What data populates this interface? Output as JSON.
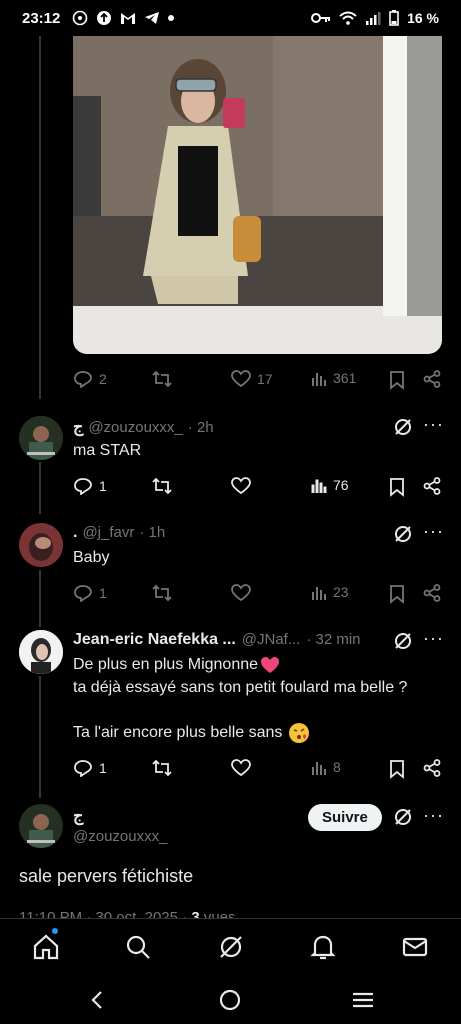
{
  "status_bar": {
    "time": "23:12",
    "battery": "16 %"
  },
  "main_post_stats": {
    "replies": "2",
    "likes": "17",
    "views": "361"
  },
  "replies": [
    {
      "name": "ج",
      "handle": "@zouzouxxx_",
      "time": "· 2h",
      "text": "ma STAR",
      "reply_count": "1",
      "views": "76"
    },
    {
      "name": ".",
      "handle": "@j_favr",
      "time": "· 1h",
      "text": "Baby",
      "reply_count": "1",
      "views": "23"
    },
    {
      "name": "Jean-eric Naefekka ...",
      "handle": "@JNaf...",
      "time": "· 32 min",
      "line1": "De plus en plus Mignonne",
      "line2": "ta déjà essayé sans ton petit foulard ma belle ?",
      "line3": "Ta l'air encore plus belle sans",
      "reply_count": "1",
      "views": "8"
    }
  ],
  "focused_post": {
    "name": "ج",
    "handle": "@zouzouxxx_",
    "follow_label": "Suivre",
    "text": "sale pervers fétichiste",
    "timestamp": "11:10 PM · 30 oct. 2025 · ",
    "views_count": "3",
    "views_label": " vues"
  },
  "colors": {
    "background": "#000000",
    "text": "#e7e9ea",
    "muted": "#71767b",
    "accent": "#1d9bf0"
  },
  "icons": [
    "whatsapp-icon",
    "upload-icon",
    "gmail-icon",
    "telegram-icon",
    "key-icon",
    "wifi-icon",
    "signal-icon",
    "battery-icon",
    "reply-icon",
    "retweet-icon",
    "like-icon",
    "views-icon",
    "bookmark-icon",
    "share-icon",
    "grok-icon",
    "more-icon",
    "home-icon",
    "search-icon",
    "notifications-icon",
    "messages-icon"
  ]
}
